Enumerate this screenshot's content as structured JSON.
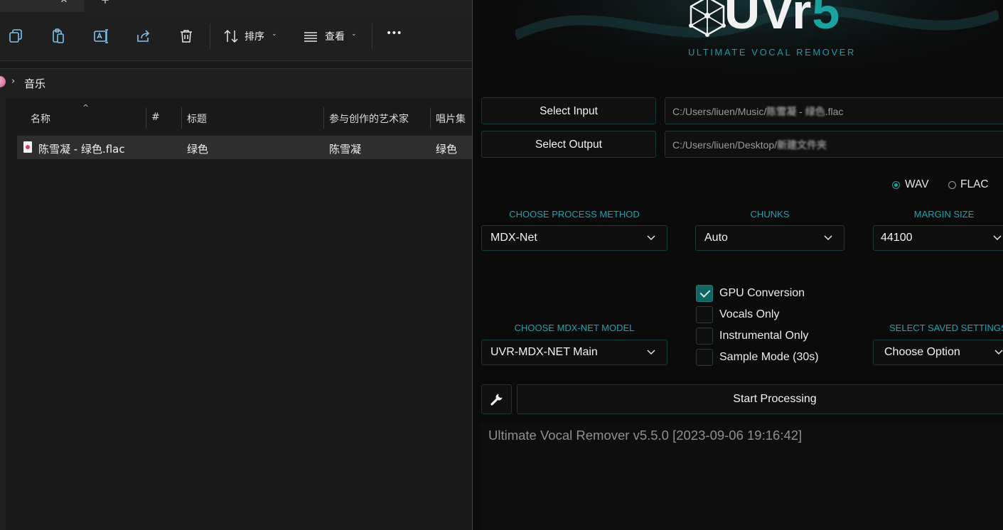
{
  "explorer": {
    "tab_close": "✕",
    "tab_new": "+",
    "toolbar": {
      "sort_label": "排序",
      "view_label": "查看",
      "more_label": "•••",
      "chevron": "⌄"
    },
    "address": {
      "chevron": "›",
      "folder": "音乐"
    },
    "columns": {
      "name": "名称",
      "number": "#",
      "title": "标题",
      "artist": "参与创作的艺术家",
      "album": "唱片集",
      "sort_indicator": "^"
    },
    "files": [
      {
        "name": "陈雪凝 - 绿色.flac",
        "title": "绿色",
        "artist": "陈雪凝",
        "album": "绿色"
      }
    ]
  },
  "uvr": {
    "logo": {
      "main": "UVr",
      "version_digit": "5",
      "subtitle": "ULTIMATE VOCAL REMOVER"
    },
    "select_input_label": "Select Input",
    "select_output_label": "Select Output",
    "input_path": {
      "prefix": "C:/Users/liuen/Music/",
      "blurred1": "陈雪凝",
      "middle": " - ",
      "blurred2": "绿色",
      "suffix": ".flac"
    },
    "output_path": {
      "prefix": "C:/Users/liuen/Desktop/",
      "blurred": "新建文件夹"
    },
    "formats": {
      "wav": "WAV",
      "flac": "FLAC",
      "selected": "WAV"
    },
    "process_method": {
      "label": "CHOOSE PROCESS METHOD",
      "value": "MDX-Net"
    },
    "chunks": {
      "label": "CHUNKS",
      "value": "Auto"
    },
    "margin_size": {
      "label": "MARGIN SIZE",
      "value": "44100"
    },
    "mdx_model": {
      "label": "CHOOSE MDX-NET MODEL",
      "value": "UVR-MDX-NET Main"
    },
    "saved_settings": {
      "label": "SELECT SAVED SETTINGS",
      "value": "Choose Option"
    },
    "options": [
      {
        "label": "GPU Conversion",
        "checked": true
      },
      {
        "label": "Vocals Only",
        "checked": false
      },
      {
        "label": "Instrumental Only",
        "checked": false
      },
      {
        "label": "Sample Mode (30s)",
        "checked": false
      }
    ],
    "start_label": "Start Processing",
    "console_text": "Ultimate Vocal Remover v5.5.0 [2023-09-06 19:16:42]",
    "accent_color": "#1aa3a0"
  }
}
